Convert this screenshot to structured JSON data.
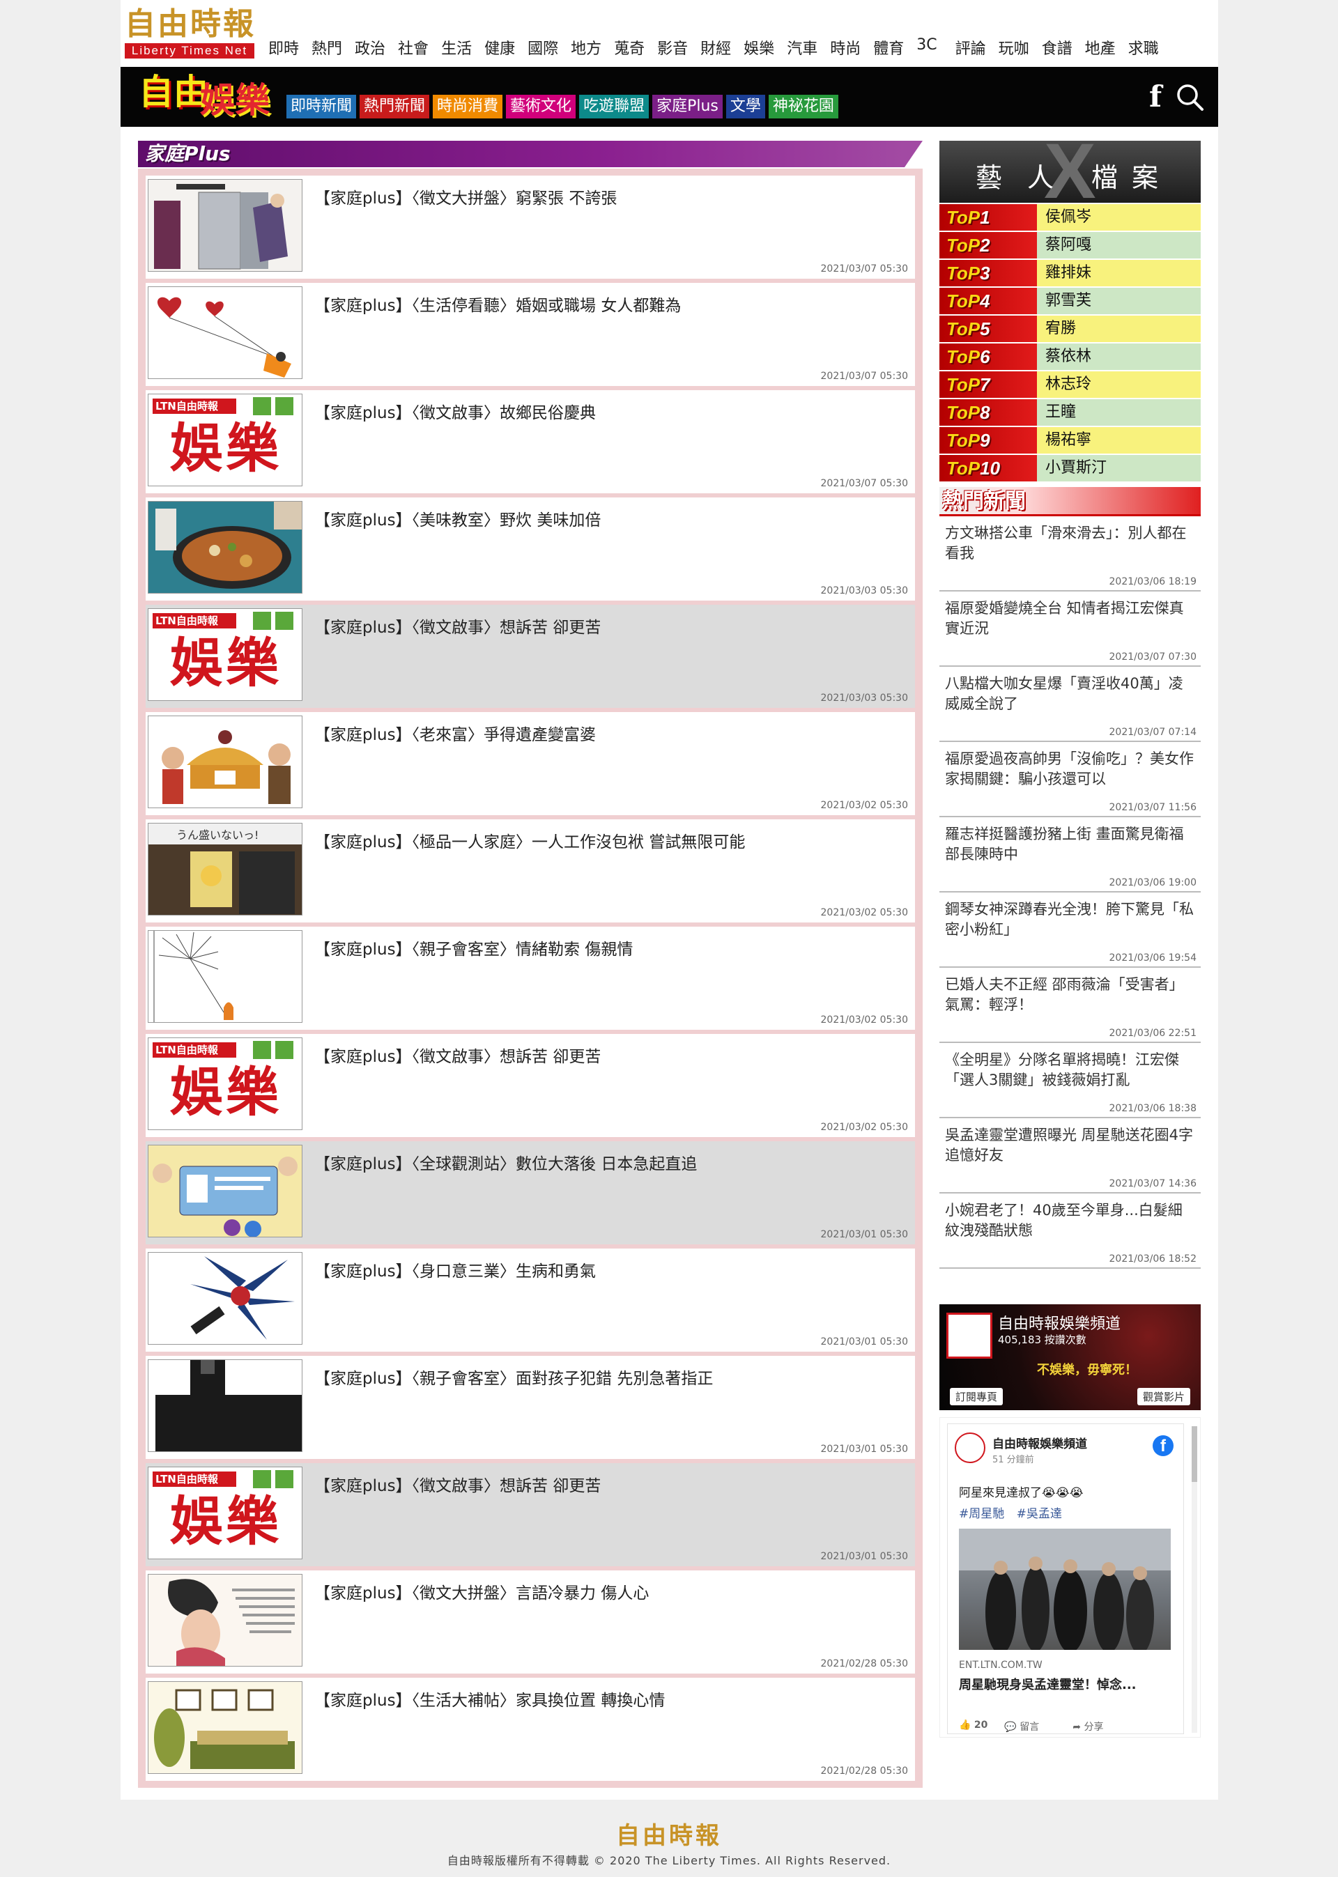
{
  "header": {
    "logo_text": "自由時報",
    "logo_sub": "Liberty Times Net",
    "categories": [
      "即時",
      "熱門",
      "政治",
      "社會",
      "生活",
      "健康",
      "國際",
      "地方",
      "蒐奇",
      "影音",
      "財經",
      "娛樂",
      "汽車",
      "時尚",
      "體育",
      "3C",
      "評論",
      "玩咖",
      "食譜",
      "地產",
      "求職"
    ]
  },
  "ent_nav": {
    "logo_a": "自由",
    "logo_b": "娛樂",
    "items": [
      {
        "label": "即時新聞",
        "color": "#1f6fb4"
      },
      {
        "label": "熱門新聞",
        "color": "#c81c1c"
      },
      {
        "label": "時尚消費",
        "color": "#f08a00"
      },
      {
        "label": "藝術文化",
        "color": "#d1007b"
      },
      {
        "label": "吃遊聯盟",
        "color": "#0d8a8a"
      },
      {
        "label": "家庭Plus",
        "color": "#7b1f87"
      },
      {
        "label": "文學",
        "color": "#1c3f95"
      },
      {
        "label": "神祕花園",
        "color": "#279a3c"
      }
    ],
    "fb_icon": "facebook-icon",
    "search_icon": "search-icon"
  },
  "section": {
    "title": "家庭Plus",
    "articles": [
      {
        "title": "【家庭plus】〈徵文大拼盤〉窮緊張 不誇張",
        "date": "2021/03/07 05:30",
        "thumb": "illustration-woman-door",
        "grey": false
      },
      {
        "title": "【家庭plus】〈生活停看聽〉婚姻或職場 女人都難為",
        "date": "2021/03/07 05:30",
        "thumb": "illustration-heart-balloons",
        "grey": false
      },
      {
        "title": "【家庭plus】〈徵文啟事〉故鄉民俗慶典",
        "date": "2021/03/07 05:30",
        "thumb": "ltn-ent-logo",
        "grey": false
      },
      {
        "title": "【家庭plus】〈美味教室〉野炊 美味加倍",
        "date": "2021/03/03 05:30",
        "thumb": "photo-pan-cooking",
        "grey": false
      },
      {
        "title": "【家庭plus】〈徵文啟事〉想訴苦 卻更苦",
        "date": "2021/03/03 05:30",
        "thumb": "ltn-ent-logo",
        "grey": true
      },
      {
        "title": "【家庭plus】〈老來富〉爭得遺產變富婆",
        "date": "2021/03/02 05:30",
        "thumb": "illustration-inheritance",
        "grey": false
      },
      {
        "title": "【家庭plus】〈極品一人家庭〉一人工作沒包袱 嘗試無限可能",
        "date": "2021/03/02 05:30",
        "thumb": "photo-shopfront",
        "grey": false
      },
      {
        "title": "【家庭plus】〈親子會客室〉情緒勒索 傷親情",
        "date": "2021/03/02 05:30",
        "thumb": "illustration-dandelion",
        "grey": false
      },
      {
        "title": "【家庭plus】〈徵文啟事〉想訴苦 卻更苦",
        "date": "2021/03/02 05:30",
        "thumb": "ltn-ent-logo",
        "grey": false
      },
      {
        "title": "【家庭plus】〈全球觀測站〉數位大落後 日本急起直追",
        "date": "2021/03/01 05:30",
        "thumb": "illustration-id-card",
        "grey": true
      },
      {
        "title": "【家庭plus】〈身口意三業〉生病和勇氣",
        "date": "2021/03/01 05:30",
        "thumb": "illustration-flower-burst",
        "grey": false
      },
      {
        "title": "【家庭plus】〈親子會客室〉面對孩子犯錯 先別急著指正",
        "date": "2021/03/01 05:30",
        "thumb": "illustration-dark-silhouette",
        "grey": false
      },
      {
        "title": "【家庭plus】〈徵文啟事〉想訴苦 卻更苦",
        "date": "2021/03/01 05:30",
        "thumb": "ltn-ent-logo",
        "grey": true
      },
      {
        "title": "【家庭plus】〈徵文大拼盤〉言語冷暴力 傷人心",
        "date": "2021/02/28 05:30",
        "thumb": "illustration-woman-words",
        "grey": false
      },
      {
        "title": "【家庭plus】〈生活大補帖〉家具換位置 轉換心情",
        "date": "2021/02/28 05:30",
        "thumb": "illustration-living-room",
        "grey": false
      }
    ]
  },
  "thumb_ltn": {
    "a": "LTN自由時報",
    "b": "娛樂"
  },
  "sidebar": {
    "xfile_a": "藝人",
    "xfile_x": "X",
    "xfile_b": "檔案",
    "top_prefix": "ToP",
    "top_list": [
      {
        "rank": "1",
        "name": "侯佩岑"
      },
      {
        "rank": "2",
        "name": "蔡阿嘎"
      },
      {
        "rank": "3",
        "name": "雞排妹"
      },
      {
        "rank": "4",
        "name": "郭雪芙"
      },
      {
        "rank": "5",
        "name": "宥勝"
      },
      {
        "rank": "6",
        "name": "蔡依林"
      },
      {
        "rank": "7",
        "name": "林志玲"
      },
      {
        "rank": "8",
        "name": "王瞳"
      },
      {
        "rank": "9",
        "name": "楊祐寧"
      },
      {
        "rank": "10",
        "name": "小賈斯汀"
      }
    ],
    "hot_title": "熱門新聞",
    "hot_news": [
      {
        "title": "方文琳搭公車「滑來滑去」：別人都在看我",
        "date": "2021/03/06 18:19"
      },
      {
        "title": "福原愛婚變燒全台 知情者揭江宏傑真實近況",
        "date": "2021/03/07 07:30"
      },
      {
        "title": "八點檔大咖女星爆「賣淫收40萬」凌威威全說了",
        "date": "2021/03/07 07:14"
      },
      {
        "title": "福原愛過夜高帥男「沒偷吃」？美女作家揭關鍵：騙小孩還可以",
        "date": "2021/03/07 11:56"
      },
      {
        "title": "羅志祥挺醫護扮豬上街 畫面驚見衛福部長陳時中",
        "date": "2021/03/06 19:00"
      },
      {
        "title": "鋼琴女神深蹲春光全洩！胯下驚見「私密小粉紅」",
        "date": "2021/03/06 19:54"
      },
      {
        "title": "已婚人夫不正經 邵雨薇淪「受害者」氣罵：輕浮！",
        "date": "2021/03/06 22:51"
      },
      {
        "title": "《全明星》分隊名單將揭曉！江宏傑「選人3關鍵」被錢薇娟打亂",
        "date": "2021/03/06 18:38"
      },
      {
        "title": "吳孟達靈堂遭照曝光 周星馳送花圈4字追憶好友",
        "date": "2021/03/07 14:36"
      },
      {
        "title": "小婉君老了！40歲至今單身...白髮細紋洩殘酷狀態",
        "date": "2021/03/06 18:52"
      }
    ],
    "youtube": {
      "channel": "自由時報娛樂頻道",
      "views": "405,183 按讚次數",
      "slogan": "不娛樂，毋寧死！",
      "subscribe": "訂閱專頁",
      "watch": "觀賞影片"
    },
    "fb_post": {
      "page": "自由時報娛樂頻道",
      "time": "51 分鐘前",
      "text": "阿星來見達叔了😭😭😭",
      "tags": "#周星馳 #吳孟達",
      "link_source": "ENT.LTN.COM.TW",
      "link_title": "周星馳現身吳孟達靈堂！悼念...",
      "likes": "20",
      "comment": "留言",
      "share": "分享"
    }
  },
  "footer": {
    "logo": "自由時報",
    "copyright": "自由時報版權所有不得轉載 © 2020 The Liberty Times. All Rights Reserved."
  }
}
